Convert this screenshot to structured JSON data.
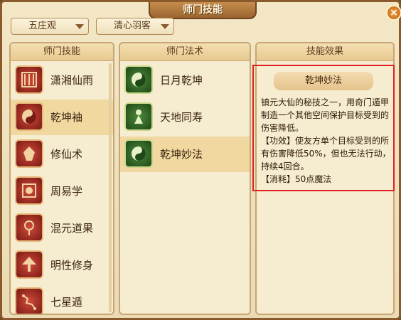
{
  "window": {
    "title": "师门技能",
    "close_label": "×"
  },
  "filters": {
    "school": "五庄观",
    "character": "清心羽客"
  },
  "skills_panel": {
    "header": "师门技能",
    "items": [
      {
        "label": "潇湘仙雨",
        "icon": "rain-icon"
      },
      {
        "label": "乾坤袖",
        "icon": "yinyang-sleeve-icon",
        "selected": true
      },
      {
        "label": "修仙术",
        "icon": "warrior-icon"
      },
      {
        "label": "周易学",
        "icon": "bagua-icon"
      },
      {
        "label": "混元道果",
        "icon": "orb-icon"
      },
      {
        "label": "明性修身",
        "icon": "tree-icon"
      },
      {
        "label": "七星遁",
        "icon": "constellation-icon"
      }
    ]
  },
  "spells_panel": {
    "header": "师门法术",
    "items": [
      {
        "label": "日月乾坤",
        "icon": "yinyang-icon"
      },
      {
        "label": "天地同寿",
        "icon": "figure-icon"
      },
      {
        "label": "乾坤妙法",
        "icon": "yinyang-icon",
        "selected": true
      }
    ]
  },
  "effect_panel": {
    "header": "技能效果",
    "title": "乾坤妙法",
    "lines": [
      "镇元大仙的秘技之一，用奇门遁甲制造一个其他空间保护目标受到的伤害降低。",
      "【功效】使友方单个目标受到的所有伤害降低50%，但也无法行动，持续4回合。",
      "【消耗】50点魔法"
    ]
  }
}
